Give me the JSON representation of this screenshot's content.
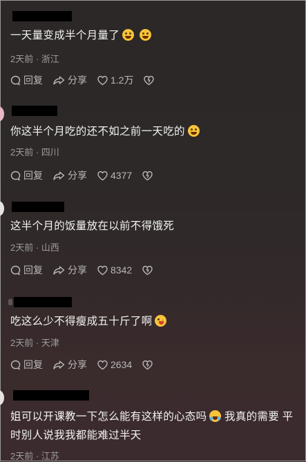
{
  "comments": [
    {
      "text": "一天量变成半个月量了",
      "location": "2天前 · 浙江",
      "reply_label": "回复",
      "share_label": "分享",
      "likes": "1.2万"
    },
    {
      "text": "你这半个月吃的还不如之前一天吃的",
      "location": "2天前 · 四川",
      "reply_label": "回复",
      "share_label": "分享",
      "likes": "4377"
    },
    {
      "text": "这半个月的饭量放在以前不得饿死",
      "location": "2天前 · 山西",
      "reply_label": "回复",
      "share_label": "分享",
      "likes": "8342"
    },
    {
      "text": "吃这么少不得瘦成五十斤了啊",
      "location": "2天前 · 天津",
      "reply_label": "回复",
      "share_label": "分享",
      "likes": "2634"
    },
    {
      "text_line1": "姐可以开课教一下怎么能有这样的心态吗",
      "text_line1b": " 我真的需要 平",
      "text_line2": "时别人说我我都能难过半天",
      "location": "2天前 · 江苏"
    }
  ],
  "icons": {
    "reply": "comment-bubble-icon",
    "share": "share-arrow-icon",
    "like": "heart-icon",
    "dislike": "broken-heart-icon",
    "emoji": "emoji-icon"
  },
  "colors": {
    "text": "#f2f2f2",
    "meta": "#9d9d9d",
    "action": "#b9b9b9"
  }
}
